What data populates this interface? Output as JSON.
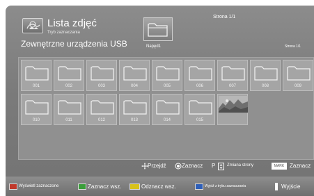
{
  "header": {
    "title": "Lista zdjęć",
    "subtitle": "Tryb zaznaczania",
    "source": "Zewnętrzne urządzenia USB",
    "drive_label": "Napęd1",
    "page_top": "Strona 1/1",
    "page_right": "Strona 1/1"
  },
  "folders": [
    "001",
    "002",
    "003",
    "004",
    "005",
    "006",
    "007",
    "008",
    "009",
    "010",
    "011",
    "012",
    "013",
    "014",
    "015"
  ],
  "hints": {
    "navigate": "Przejdź",
    "select": "Zaznacz",
    "p_label": "P",
    "page_change": "Zmiana strony",
    "mark_key": "MARK",
    "mark": "Zaznacz"
  },
  "bottom": {
    "show_marked": "Wyświetl zaznaczone",
    "select_all": "Zaznacz wsz.",
    "deselect_all": "Odznacz wsz.",
    "exit_mark_mode": "Wyjdź z trybu zaznaczania",
    "exit": "Wyjście"
  },
  "colors": {
    "red": "#c0392b",
    "green": "#3a9e3a",
    "yellow": "#d8c21a",
    "blue": "#2e5fb8"
  }
}
